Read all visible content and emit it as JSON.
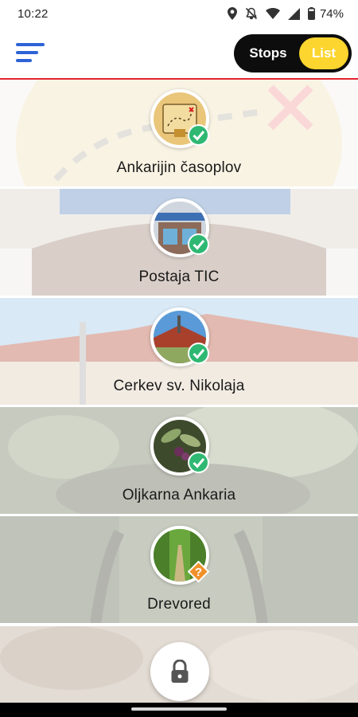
{
  "status_bar": {
    "time": "10:22",
    "battery_percent": "74%",
    "icons": [
      "location-icon",
      "mute-icon",
      "wifi-icon",
      "signal-icon",
      "battery-icon"
    ]
  },
  "header": {
    "menu_icon": "hamburger-menu-icon",
    "toggle": {
      "stops_label": "Stops",
      "list_label": "List",
      "selected": "List"
    },
    "accent_color": "#e3232e",
    "menu_color": "#2d63d6",
    "toggle_active_color": "#fcd52e"
  },
  "stops": [
    {
      "name": "Ankarijin časoplov",
      "status": "completed",
      "status_icon": "check-icon",
      "thumbnail": "treasure-map-icon"
    },
    {
      "name": "Postaja TIC",
      "status": "completed",
      "status_icon": "check-icon",
      "thumbnail": "tourist-info-building"
    },
    {
      "name": "Cerkev sv. Nikolaja",
      "status": "completed",
      "status_icon": "check-icon",
      "thumbnail": "church-roof"
    },
    {
      "name": "Oljkarna Ankaria",
      "status": "completed",
      "status_icon": "check-icon",
      "thumbnail": "olive-branch"
    },
    {
      "name": "Drevored",
      "status": "unknown",
      "status_icon": "question-icon",
      "thumbnail": "tree-alley"
    }
  ],
  "colors": {
    "completed_badge": "#2eb872",
    "unknown_badge": "#f0902a"
  },
  "bottom": {
    "lock_icon": "padlock-icon"
  }
}
